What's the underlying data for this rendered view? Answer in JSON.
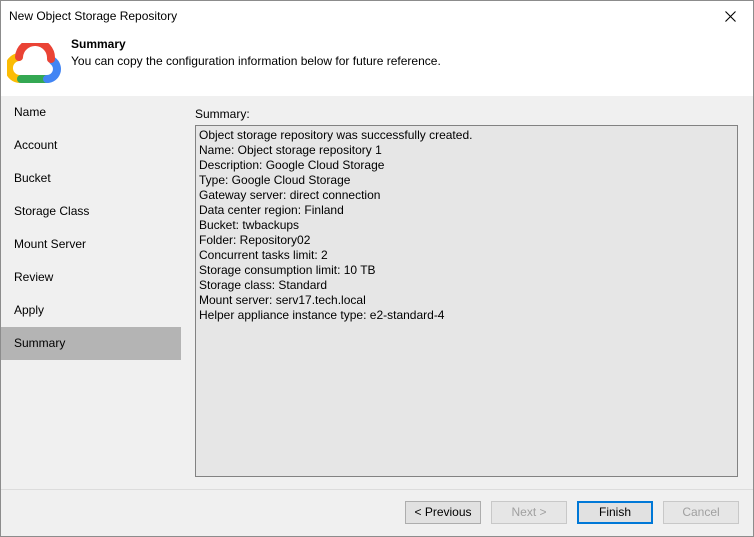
{
  "window": {
    "title": "New Object Storage Repository"
  },
  "header": {
    "title": "Summary",
    "subtitle": "You can copy the configuration information below for future reference.",
    "logo_icon": "google-cloud-logo"
  },
  "nav": {
    "items": [
      {
        "label": "Name"
      },
      {
        "label": "Account"
      },
      {
        "label": "Bucket"
      },
      {
        "label": "Storage Class"
      },
      {
        "label": "Mount Server"
      },
      {
        "label": "Review"
      },
      {
        "label": "Apply"
      },
      {
        "label": "Summary"
      }
    ],
    "active": "Summary"
  },
  "summary": {
    "label": "Summary:",
    "lines": [
      "Object storage repository was successfully created.",
      "Name: Object storage repository 1",
      "Description: Google Cloud Storage",
      "Type: Google Cloud Storage",
      "Gateway server: direct connection",
      "Data center region: Finland",
      "Bucket: twbackups",
      "Folder: Repository02",
      "Concurrent tasks limit: 2",
      "Storage consumption limit: 10 TB",
      "Storage class: Standard",
      "Mount server: serv17.tech.local",
      "Helper appliance instance type: e2-standard-4"
    ]
  },
  "buttons": {
    "previous": "< Previous",
    "next": "Next >",
    "finish": "Finish",
    "cancel": "Cancel"
  },
  "colors": {
    "active_nav": "#b4b4b4",
    "accent": "#0078d7",
    "logo_red": "#ea4335",
    "logo_blue": "#4285f4",
    "logo_yellow": "#fbbc04",
    "logo_green": "#34a853"
  }
}
